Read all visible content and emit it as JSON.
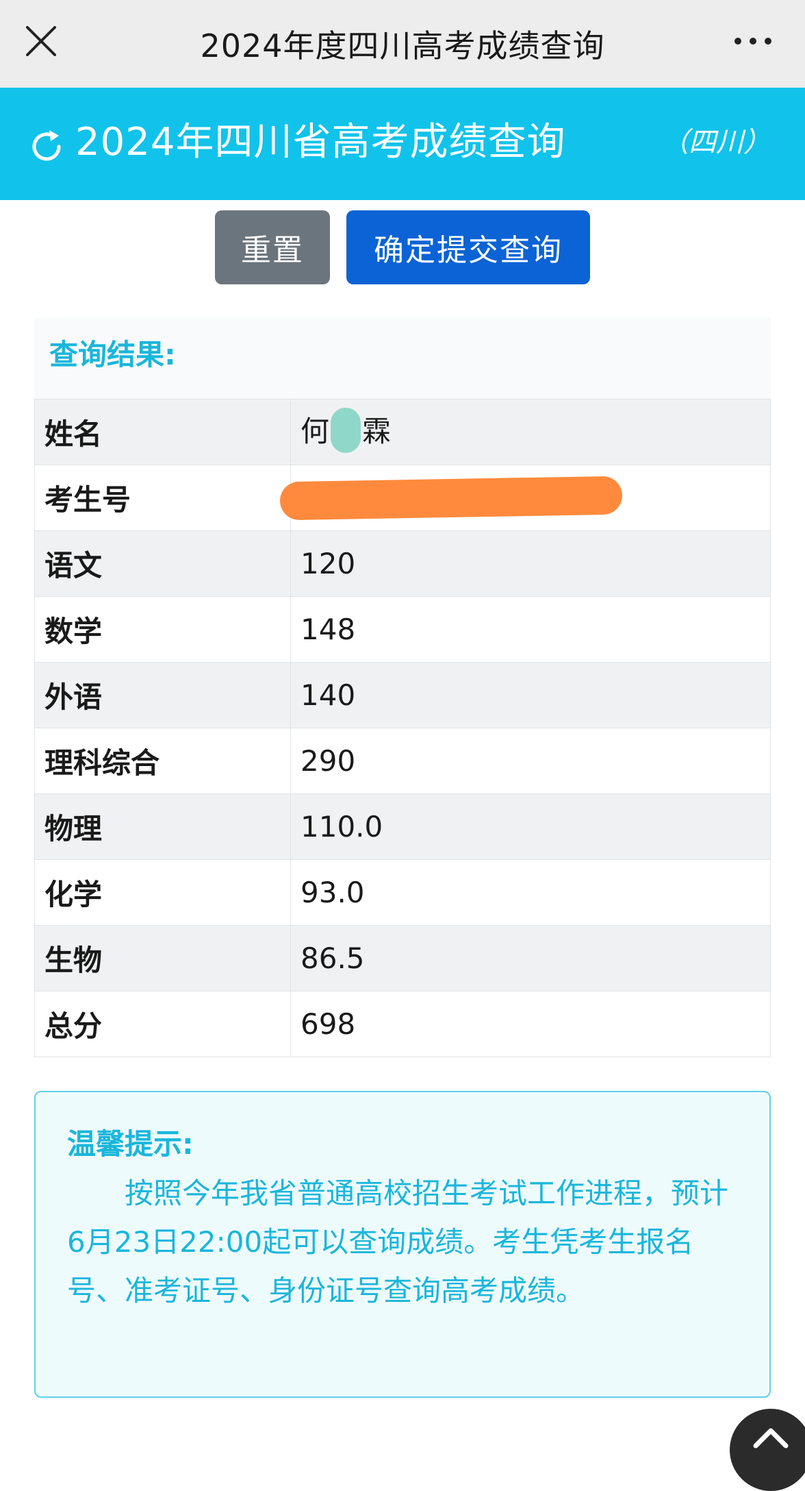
{
  "navbar": {
    "title": "2024年度四川高考成绩查询",
    "close_icon": "close-icon",
    "more_icon": "more-horizontal-icon"
  },
  "banner": {
    "title": "2024年四川省高考成绩查询",
    "region": "（四川）",
    "refresh_icon": "refresh-icon",
    "color": "#11c3ea"
  },
  "buttons": {
    "reset_label": "重置",
    "submit_label": "确定提交查询"
  },
  "result": {
    "header": "查询结果:",
    "rows": [
      {
        "label": "姓名",
        "value_parts": [
          "何",
          "霖"
        ]
      },
      {
        "label": "考生号",
        "value": ""
      },
      {
        "label": "语文",
        "value": "120"
      },
      {
        "label": "数学",
        "value": "148"
      },
      {
        "label": "外语",
        "value": "140"
      },
      {
        "label": "理科综合",
        "value": "290"
      },
      {
        "label": "物理",
        "value": "110.0"
      },
      {
        "label": "化学",
        "value": "93.0"
      },
      {
        "label": "生物",
        "value": "86.5"
      },
      {
        "label": "总分",
        "value": "698"
      }
    ]
  },
  "tip": {
    "title": "温馨提示:",
    "body": "按照今年我省普通高校招生考试工作进程，预计6月23日22:00起可以查询成绩。考生凭考生报名号、准考证号、身份证号查询高考成绩。"
  },
  "colors": {
    "accent": "#1ab6db",
    "submit_button": "#0b63d6",
    "reset_button": "#6b757d",
    "redaction": "#ff8a3d"
  }
}
